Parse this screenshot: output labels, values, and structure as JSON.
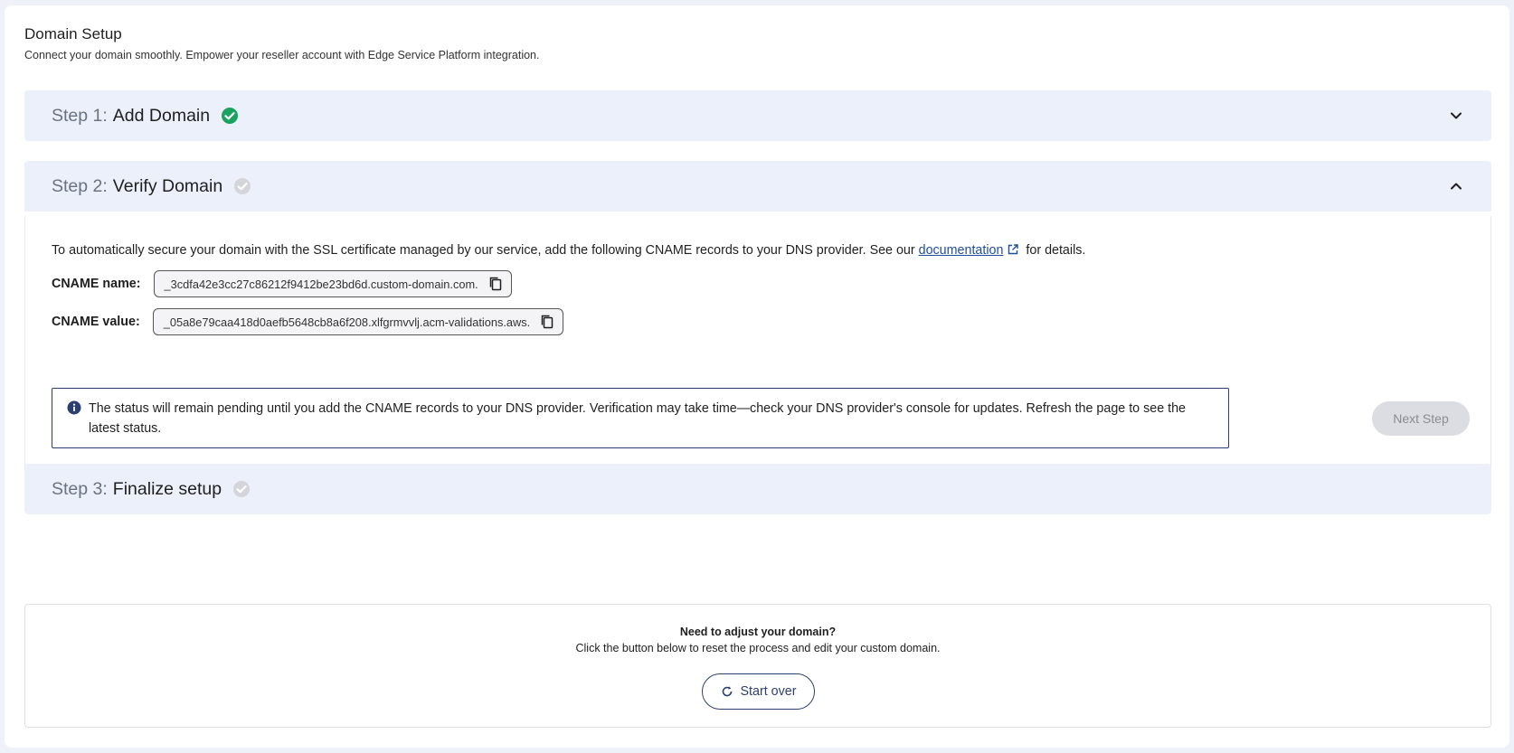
{
  "page": {
    "title": "Domain Setup",
    "subtitle": "Connect your domain smoothly. Empower your reseller account with Edge Service Platform integration."
  },
  "steps": [
    {
      "prefix": "Step 1:",
      "title": "Add Domain",
      "status": "completed",
      "expanded": false,
      "check_color": "#1aa260"
    },
    {
      "prefix": "Step 2:",
      "title": "Verify Domain",
      "status": "pending",
      "expanded": true,
      "check_color": "#d3d5da"
    },
    {
      "prefix": "Step 3:",
      "title": "Finalize setup",
      "status": "pending",
      "expanded": false,
      "check_color": "#d3d5da"
    }
  ],
  "verify": {
    "intro_before": "To automatically secure your domain with the SSL certificate managed by our service, add the following CNAME records to your DNS provider. See our ",
    "doc_link": "documentation",
    "intro_after": "for details.",
    "cname_name_label": "CNAME name:",
    "cname_name_value": "_3cdfa42e3cc27c86212f9412be23bd6d.custom-domain.com.",
    "cname_value_label": "CNAME value:",
    "cname_value_value": "_05a8e79caa418d0aefb5648cb8a6f208.xlfgrmvvlj.acm-validations.aws.",
    "info_text": "The status will remain pending until you add the CNAME records to your DNS provider. Verification may take time—check your DNS provider's console for updates. Refresh the page to see the latest status.",
    "next_button": "Next Step"
  },
  "reset": {
    "heading": "Need to adjust your domain?",
    "text": "Click the button below to reset the process and edit your custom domain.",
    "button": "Start over"
  },
  "colors": {
    "accent": "#2c3f72",
    "step_header_bg": "#ebf0fa",
    "success": "#1aa260",
    "link": "#1f4e9a"
  },
  "icons": [
    "check-circle-icon",
    "chevron-down-icon",
    "chevron-up-icon",
    "external-link-icon",
    "copy-icon",
    "info-icon",
    "refresh-icon"
  ]
}
